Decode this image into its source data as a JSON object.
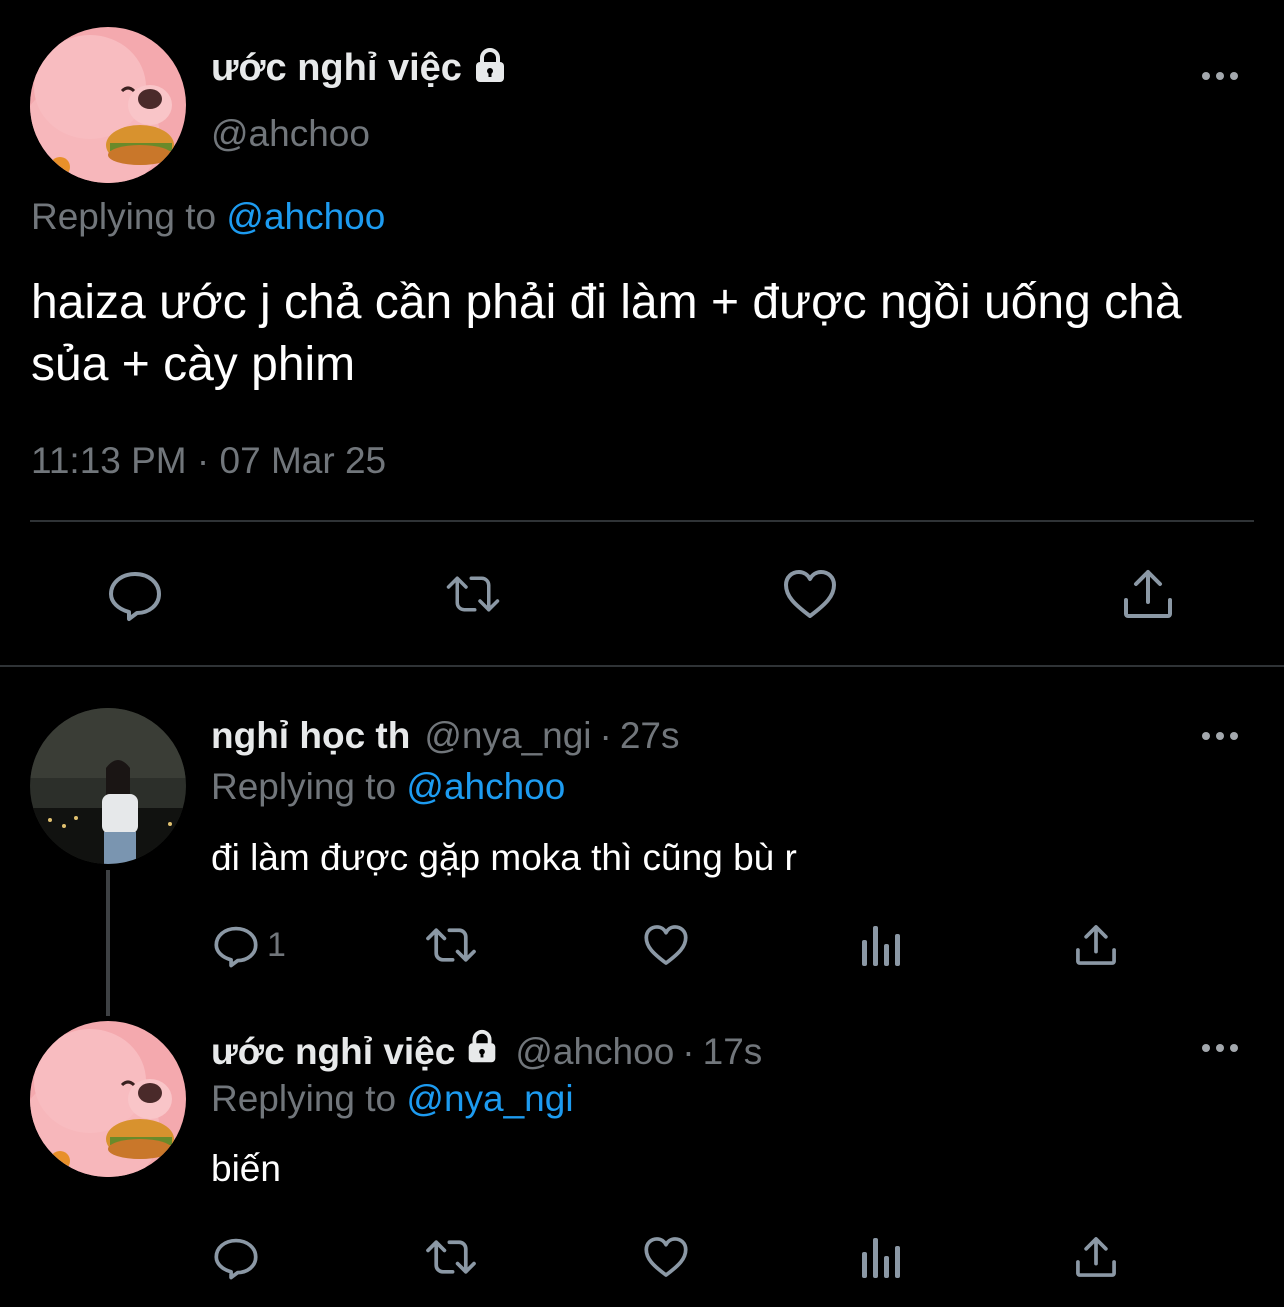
{
  "main_tweet": {
    "display_name": "ước nghỉ việc",
    "handle": "@ahchoo",
    "replying_prefix": "Replying to",
    "replying_to": "@ahchoo",
    "text": "haiza ước j chả cần phải đi làm + được ngồi uống chà sủa + cày phim",
    "timestamp": "11:13 PM · 07 Mar 25",
    "actions": [
      "reply-icon",
      "retweet-icon",
      "like-icon",
      "share-icon"
    ]
  },
  "replies": [
    {
      "display_name": "nghỉ học th",
      "handle": "@nya_ngi",
      "dot": "·",
      "time": "27s",
      "replying_prefix": "Replying to",
      "replying_to": "@ahchoo",
      "text": "đi làm được gặp moka thì cũng bù r",
      "reply_count": "1"
    },
    {
      "display_name": "ước nghỉ việc",
      "handle": "@ahchoo",
      "dot": "·",
      "time": "17s",
      "replying_prefix": "Replying to",
      "replying_to": "@nya_ngi",
      "text": "biến",
      "reply_count": ""
    }
  ],
  "colors": {
    "background": "#000000",
    "text": "#ffffff",
    "secondary": "#71767b",
    "link": "#1d9bf0",
    "divider": "#2f3336"
  }
}
